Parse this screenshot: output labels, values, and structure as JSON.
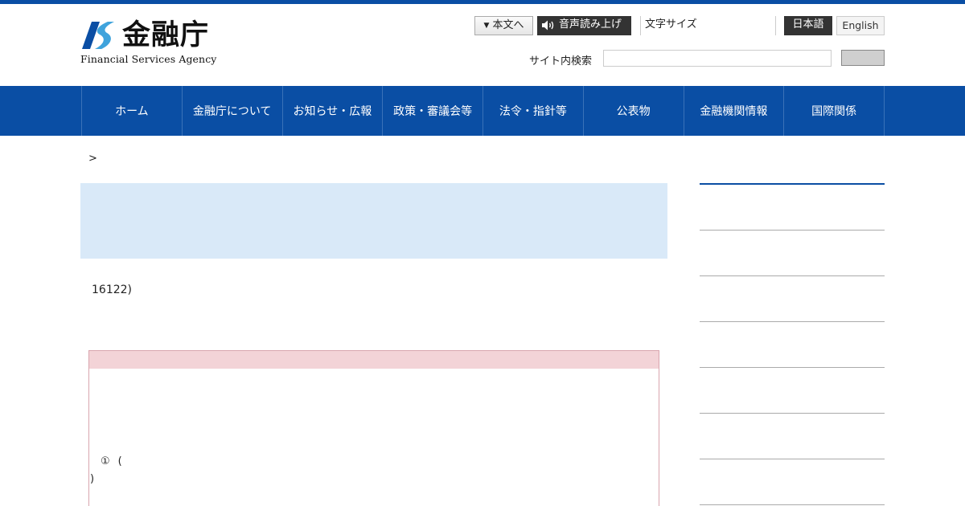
{
  "header": {
    "logo_jp": "金融庁",
    "logo_en": "Financial Services Agency"
  },
  "utility": {
    "skip_label": "本文へ",
    "voice_label": "音声読み上げ",
    "font_size_label": "文字サイズ",
    "lang_ja": "日本語",
    "lang_en": "English"
  },
  "search": {
    "label": "サイト内検索",
    "value": "",
    "button_label": ""
  },
  "nav": {
    "items": [
      {
        "label": "ホーム"
      },
      {
        "label": "金融庁について"
      },
      {
        "label": "お知らせ・広報"
      },
      {
        "label": "政策・審議会等"
      },
      {
        "label": "法令・指針等"
      },
      {
        "label": "公表物"
      },
      {
        "label": "金融機関情報"
      },
      {
        "label": "国際関係"
      }
    ]
  },
  "breadcrumb": {
    "separator": ">"
  },
  "main": {
    "date_text": "16122)",
    "notice": {
      "line1_a": "①",
      "line1_b": "(",
      "line2": ")"
    }
  },
  "colors": {
    "brand_blue": "#0a4ea4",
    "title_bg": "#d9e9f8",
    "notice_head": "#f3d3d7",
    "notice_border": "#d9a5ae"
  },
  "icons": {
    "logo_mark": "fsa-logo-mark",
    "voice": "speaker-icon",
    "skip": "triangle-down-icon"
  }
}
